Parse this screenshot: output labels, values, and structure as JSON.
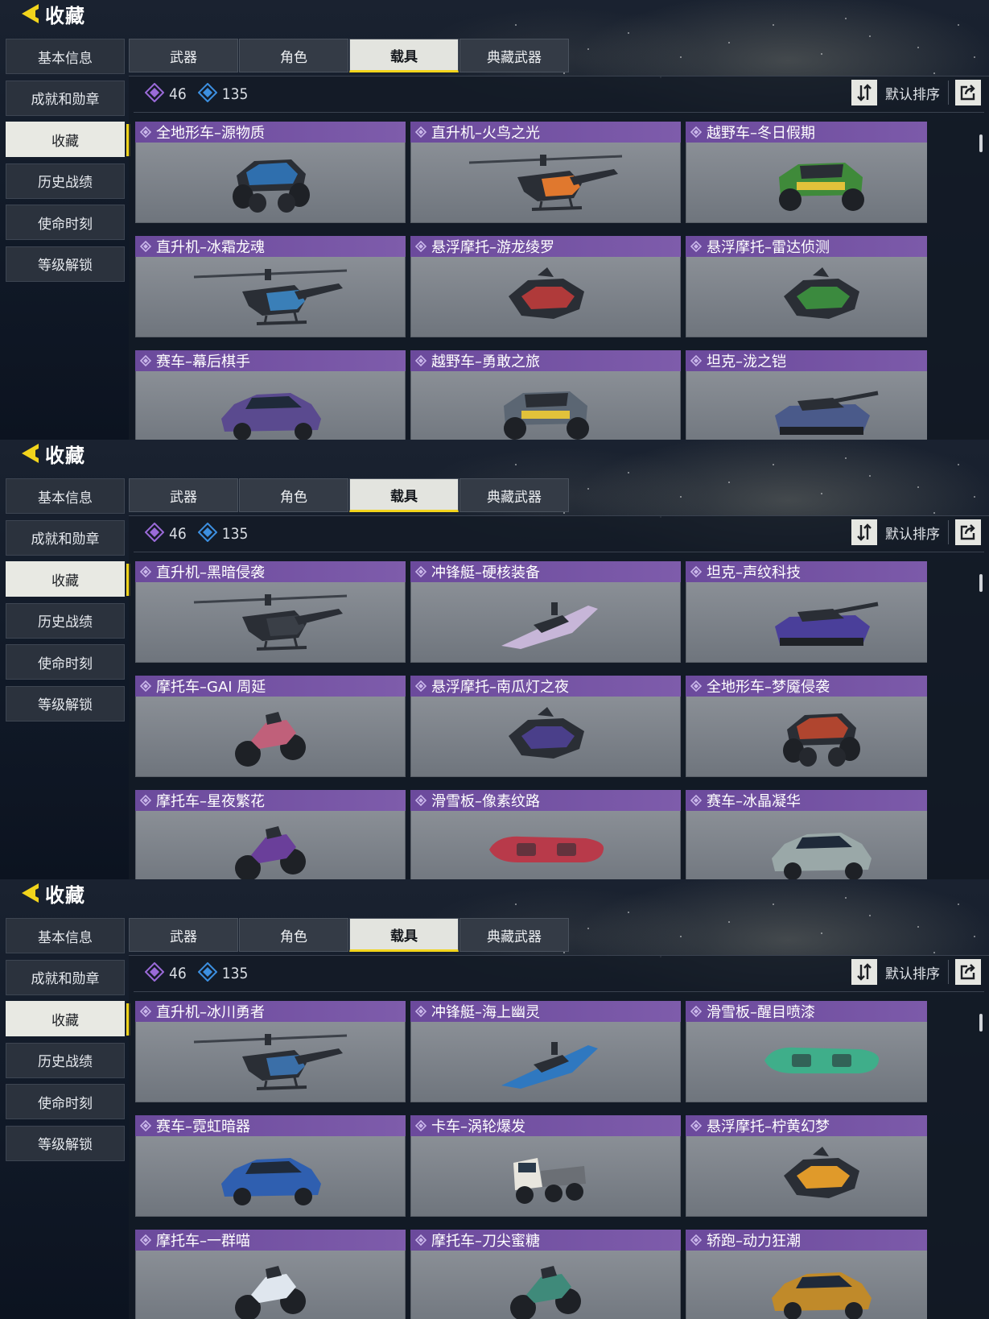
{
  "panels": [
    {
      "header": {
        "title": "收藏"
      },
      "side_nav": [
        {
          "label": "基本信息",
          "active": false
        },
        {
          "label": "成就和勋章",
          "active": false
        },
        {
          "label": "收藏",
          "active": true
        },
        {
          "label": "历史战绩",
          "active": false
        },
        {
          "label": "使命时刻",
          "active": false
        },
        {
          "label": "等级解锁",
          "active": false
        }
      ],
      "tabs": [
        {
          "label": "武器",
          "active": false
        },
        {
          "label": "角色",
          "active": false
        },
        {
          "label": "载具",
          "active": true
        },
        {
          "label": "典藏武器",
          "active": false
        }
      ],
      "stats": {
        "purple_count": "46",
        "blue_count": "135"
      },
      "sort": {
        "label": "默认排序"
      },
      "items": [
        {
          "name": "全地形车–源物质",
          "vehicle": "atv",
          "color": "#2f6fae"
        },
        {
          "name": "直升机–火鸟之光",
          "vehicle": "heli",
          "color": "#e0782e"
        },
        {
          "name": "越野车–冬日假期",
          "vehicle": "jeep",
          "color": "#3f8a3a"
        },
        {
          "name": "直升机–冰霜龙魂",
          "vehicle": "heli",
          "color": "#3a7fb8"
        },
        {
          "name": "悬浮摩托–游龙绫罗",
          "vehicle": "hover",
          "color": "#b03a3a"
        },
        {
          "name": "悬浮摩托–雷达侦测",
          "vehicle": "hover",
          "color": "#3b8a3e"
        },
        {
          "name": "赛车–幕后棋手",
          "vehicle": "car",
          "color": "#5a4a8f"
        },
        {
          "name": "越野车–勇敢之旅",
          "vehicle": "jeep",
          "color": "#5b6673"
        },
        {
          "name": "坦克–泷之铠",
          "vehicle": "tank",
          "color": "#4a5a8a"
        }
      ]
    },
    {
      "header": {
        "title": "收藏"
      },
      "side_nav": [
        {
          "label": "基本信息",
          "active": false
        },
        {
          "label": "成就和勋章",
          "active": false
        },
        {
          "label": "收藏",
          "active": true
        },
        {
          "label": "历史战绩",
          "active": false
        },
        {
          "label": "使命时刻",
          "active": false
        },
        {
          "label": "等级解锁",
          "active": false
        }
      ],
      "tabs": [
        {
          "label": "武器",
          "active": false
        },
        {
          "label": "角色",
          "active": false
        },
        {
          "label": "载具",
          "active": true
        },
        {
          "label": "典藏武器",
          "active": false
        }
      ],
      "stats": {
        "purple_count": "46",
        "blue_count": "135"
      },
      "sort": {
        "label": "默认排序"
      },
      "items": [
        {
          "name": "直升机–黑暗侵袭",
          "vehicle": "heli",
          "color": "#3a3f47"
        },
        {
          "name": "冲锋艇–硬核装备",
          "vehicle": "boat",
          "color": "#c7b6d8"
        },
        {
          "name": "坦克–声纹科技",
          "vehicle": "tank",
          "color": "#4a3f9a"
        },
        {
          "name": "摩托车–GAI 周延",
          "vehicle": "moto",
          "color": "#c0607a"
        },
        {
          "name": "悬浮摩托–南瓜灯之夜",
          "vehicle": "hover",
          "color": "#4a3f8a"
        },
        {
          "name": "全地形车–梦魇侵袭",
          "vehicle": "atv",
          "color": "#b0452f"
        },
        {
          "name": "摩托车–星夜繁花",
          "vehicle": "moto",
          "color": "#6a3f9a"
        },
        {
          "name": "滑雪板–像素纹路",
          "vehicle": "board",
          "color": "#b83a4a"
        },
        {
          "name": "赛车–冰晶凝华",
          "vehicle": "car",
          "color": "#9aa8a8"
        }
      ]
    },
    {
      "header": {
        "title": "收藏"
      },
      "side_nav": [
        {
          "label": "基本信息",
          "active": false
        },
        {
          "label": "成就和勋章",
          "active": false
        },
        {
          "label": "收藏",
          "active": true
        },
        {
          "label": "历史战绩",
          "active": false
        },
        {
          "label": "使命时刻",
          "active": false
        },
        {
          "label": "等级解锁",
          "active": false
        }
      ],
      "tabs": [
        {
          "label": "武器",
          "active": false
        },
        {
          "label": "角色",
          "active": false
        },
        {
          "label": "载具",
          "active": true
        },
        {
          "label": "典藏武器",
          "active": false
        }
      ],
      "stats": {
        "purple_count": "46",
        "blue_count": "135"
      },
      "sort": {
        "label": "默认排序"
      },
      "items": [
        {
          "name": "直升机–冰川勇者",
          "vehicle": "heli",
          "color": "#3b6fa8"
        },
        {
          "name": "冲锋艇–海上幽灵",
          "vehicle": "boat",
          "color": "#2f78c0"
        },
        {
          "name": "滑雪板–醒目喷漆",
          "vehicle": "board",
          "color": "#3fae8a"
        },
        {
          "name": "赛车–霓虹暗器",
          "vehicle": "car",
          "color": "#2f5fb0"
        },
        {
          "name": "卡车–涡轮爆发",
          "vehicle": "truck",
          "color": "#e8e6de"
        },
        {
          "name": "悬浮摩托–柠黄幻梦",
          "vehicle": "hover",
          "color": "#e09a2a"
        },
        {
          "name": "摩托车–一群喵",
          "vehicle": "moto",
          "color": "#dfe6ee"
        },
        {
          "name": "摩托车–刀尖蜜糖",
          "vehicle": "moto",
          "color": "#3f8a7a"
        },
        {
          "name": "轿跑–动力狂潮",
          "vehicle": "car",
          "color": "#c08a2a"
        }
      ]
    }
  ]
}
